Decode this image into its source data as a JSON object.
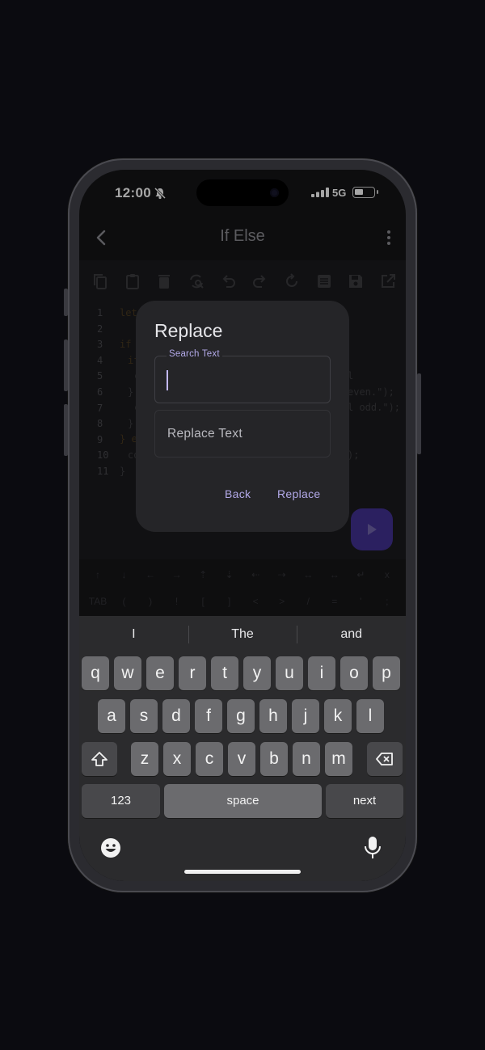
{
  "status": {
    "time": "12:00",
    "network": "5G",
    "bell_icon": "bell-slash-icon",
    "battery_level": 0.45
  },
  "header": {
    "title": "If Else",
    "back_icon": "chevron-left-icon",
    "menu_icon": "more-vertical-icon"
  },
  "toolbar": {
    "icons": [
      "copy-icon",
      "paste-icon",
      "delete-icon",
      "find-replace-icon",
      "undo-icon",
      "redo-icon",
      "refresh-icon",
      "format-icon",
      "save-icon",
      "share-icon"
    ]
  },
  "editor": {
    "line_numbers": [
      "1",
      "2",
      "3",
      "4",
      "5",
      "6",
      "7",
      "8",
      "9",
      "10",
      "11"
    ],
    "visible_fragments": {
      "l1": "let",
      "l3": "if (",
      "l4": "if",
      "l5a": "c",
      "l5b": "l even.\");",
      "l6": "}",
      "l7a": "c",
      "l7b": "l odd.\");",
      "l8": "}",
      "l9": "} e",
      "l10a": "co",
      "l10b": ");",
      "l11": "}"
    }
  },
  "symbols": {
    "row1": [
      "↑",
      "↓",
      "←",
      "→",
      "⇡",
      "⇣",
      "⇠",
      "⇢",
      "↔",
      "↔",
      "↵",
      "x"
    ],
    "row2": [
      "TAB",
      "(",
      ")",
      "!",
      "[",
      "]",
      "<",
      ">",
      "/",
      "=",
      "'",
      ";"
    ]
  },
  "dialog": {
    "title": "Replace",
    "search_label": "Search Text",
    "search_value": "",
    "replace_placeholder": "Replace Text",
    "back_label": "Back",
    "replace_label": "Replace"
  },
  "keyboard": {
    "suggestions": [
      "I",
      "The",
      "and"
    ],
    "row1": [
      "q",
      "w",
      "e",
      "r",
      "t",
      "y",
      "u",
      "i",
      "o",
      "p"
    ],
    "row2": [
      "a",
      "s",
      "d",
      "f",
      "g",
      "h",
      "j",
      "k",
      "l"
    ],
    "row3": [
      "z",
      "x",
      "c",
      "v",
      "b",
      "n",
      "m"
    ],
    "numbers_label": "123",
    "space_label": "space",
    "next_label": "next",
    "shift_icon": "shift-icon",
    "delete_icon": "backspace-icon",
    "emoji_icon": "emoji-icon",
    "mic_icon": "microphone-icon"
  },
  "colors": {
    "accent": "#b2a9e8",
    "run_button": "#2b2060",
    "background": "#141416"
  }
}
